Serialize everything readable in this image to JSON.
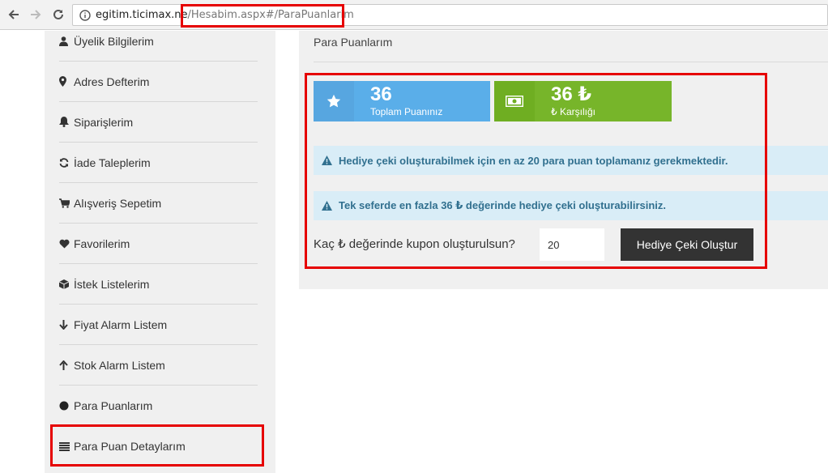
{
  "browser": {
    "url_host": "egitim.ticimax.ne",
    "url_path": "/Hesabim.aspx#/ParaPuanlarim"
  },
  "sidebar": {
    "items": [
      {
        "label": "Üyelik Bilgilerim",
        "icon": "user-icon"
      },
      {
        "label": "Adres Defterim",
        "icon": "map-marker-icon"
      },
      {
        "label": "Siparişlerim",
        "icon": "bell-icon"
      },
      {
        "label": "İade Taleplerim",
        "icon": "refresh-icon"
      },
      {
        "label": "Alışveriş Sepetim",
        "icon": "cart-icon"
      },
      {
        "label": "Favorilerim",
        "icon": "heart-icon"
      },
      {
        "label": "İstek Listelerim",
        "icon": "box-icon"
      },
      {
        "label": "Fiyat Alarm Listem",
        "icon": "arrow-down-icon"
      },
      {
        "label": "Stok Alarm Listem",
        "icon": "arrow-up-icon"
      },
      {
        "label": "Para Puanlarım",
        "icon": "circle-icon"
      },
      {
        "label": "Para Puan Detaylarım",
        "icon": "list-icon"
      }
    ]
  },
  "main": {
    "title": "Para Puanlarım",
    "stats": [
      {
        "value": "36",
        "label": "Toplam Puanınız",
        "icon": "star-icon",
        "color": "#5aaee9",
        "icon_bg": "#57a6e0"
      },
      {
        "value": "36 ₺",
        "label": "₺ Karşılığı",
        "icon": "money-icon",
        "color": "#77b52a",
        "icon_bg": "#6fae22"
      }
    ],
    "alerts": [
      "Hediye çeki oluşturabilmek için en az 20 para puan toplamanız gerekmektedir.",
      "Tek seferde en fazla 36 ₺ değerinde hediye çeki oluşturabilirsiniz."
    ],
    "coupon": {
      "label": "Kaç ₺ değerinde kupon oluşturulsun?",
      "value": "20",
      "button": "Hediye Çeki Oluştur"
    }
  },
  "colors": {
    "highlight": "#e60000",
    "alert_bg": "#d9edf7",
    "alert_text": "#31708f",
    "button_bg": "#333333"
  }
}
